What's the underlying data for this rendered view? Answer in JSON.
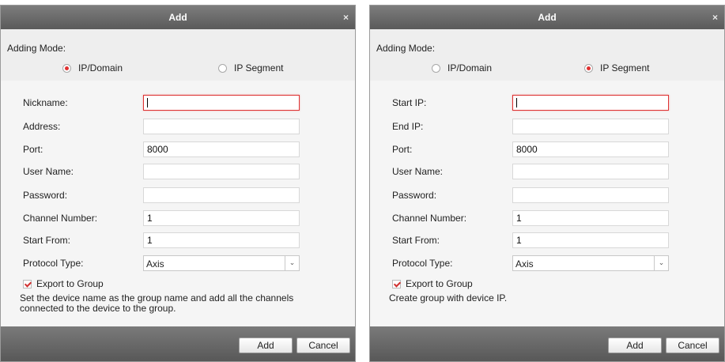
{
  "left_dialog": {
    "title": "Add",
    "close": "×",
    "adding_mode_label": "Adding Mode:",
    "mode_ip_domain": "IP/Domain",
    "mode_ip_segment": "IP Segment",
    "selected_mode": "IP/Domain",
    "fields": {
      "nickname": {
        "label": "Nickname:",
        "value": ""
      },
      "address": {
        "label": "Address:",
        "value": ""
      },
      "port": {
        "label": "Port:",
        "value": "8000"
      },
      "user_name": {
        "label": "User Name:",
        "value": ""
      },
      "password": {
        "label": "Password:",
        "value": ""
      },
      "channel_number": {
        "label": "Channel Number:",
        "value": "1"
      },
      "start_from": {
        "label": "Start From:",
        "value": "1"
      }
    },
    "protocol": {
      "label": "Protocol Type:",
      "value": "Axis"
    },
    "export_to_group": {
      "label": "Export to Group",
      "checked": true
    },
    "description": "Set the device name as the group name and add all the channels connected to the device to the group.",
    "add_button": "Add",
    "cancel_button": "Cancel"
  },
  "right_dialog": {
    "title": "Add",
    "close": "×",
    "adding_mode_label": "Adding Mode:",
    "mode_ip_domain": "IP/Domain",
    "mode_ip_segment": "IP Segment",
    "selected_mode": "IP Segment",
    "fields": {
      "start_ip": {
        "label": "Start IP:",
        "value": ""
      },
      "end_ip": {
        "label": "End IP:",
        "value": ""
      },
      "port": {
        "label": "Port:",
        "value": "8000"
      },
      "user_name": {
        "label": "User Name:",
        "value": ""
      },
      "password": {
        "label": "Password:",
        "value": ""
      },
      "channel_number": {
        "label": "Channel Number:",
        "value": "1"
      },
      "start_from": {
        "label": "Start From:",
        "value": "1"
      }
    },
    "protocol": {
      "label": "Protocol Type:",
      "value": "Axis"
    },
    "export_to_group": {
      "label": "Export to Group",
      "checked": true
    },
    "description": "Create group with device IP.",
    "add_button": "Add",
    "cancel_button": "Cancel"
  },
  "colors": {
    "titlebar": "#6b6b6b",
    "dialog_bg": "#eeeeee",
    "form_bg": "#f5f5f5",
    "accent_red": "#e03030",
    "focus_border": "#dd3333"
  }
}
